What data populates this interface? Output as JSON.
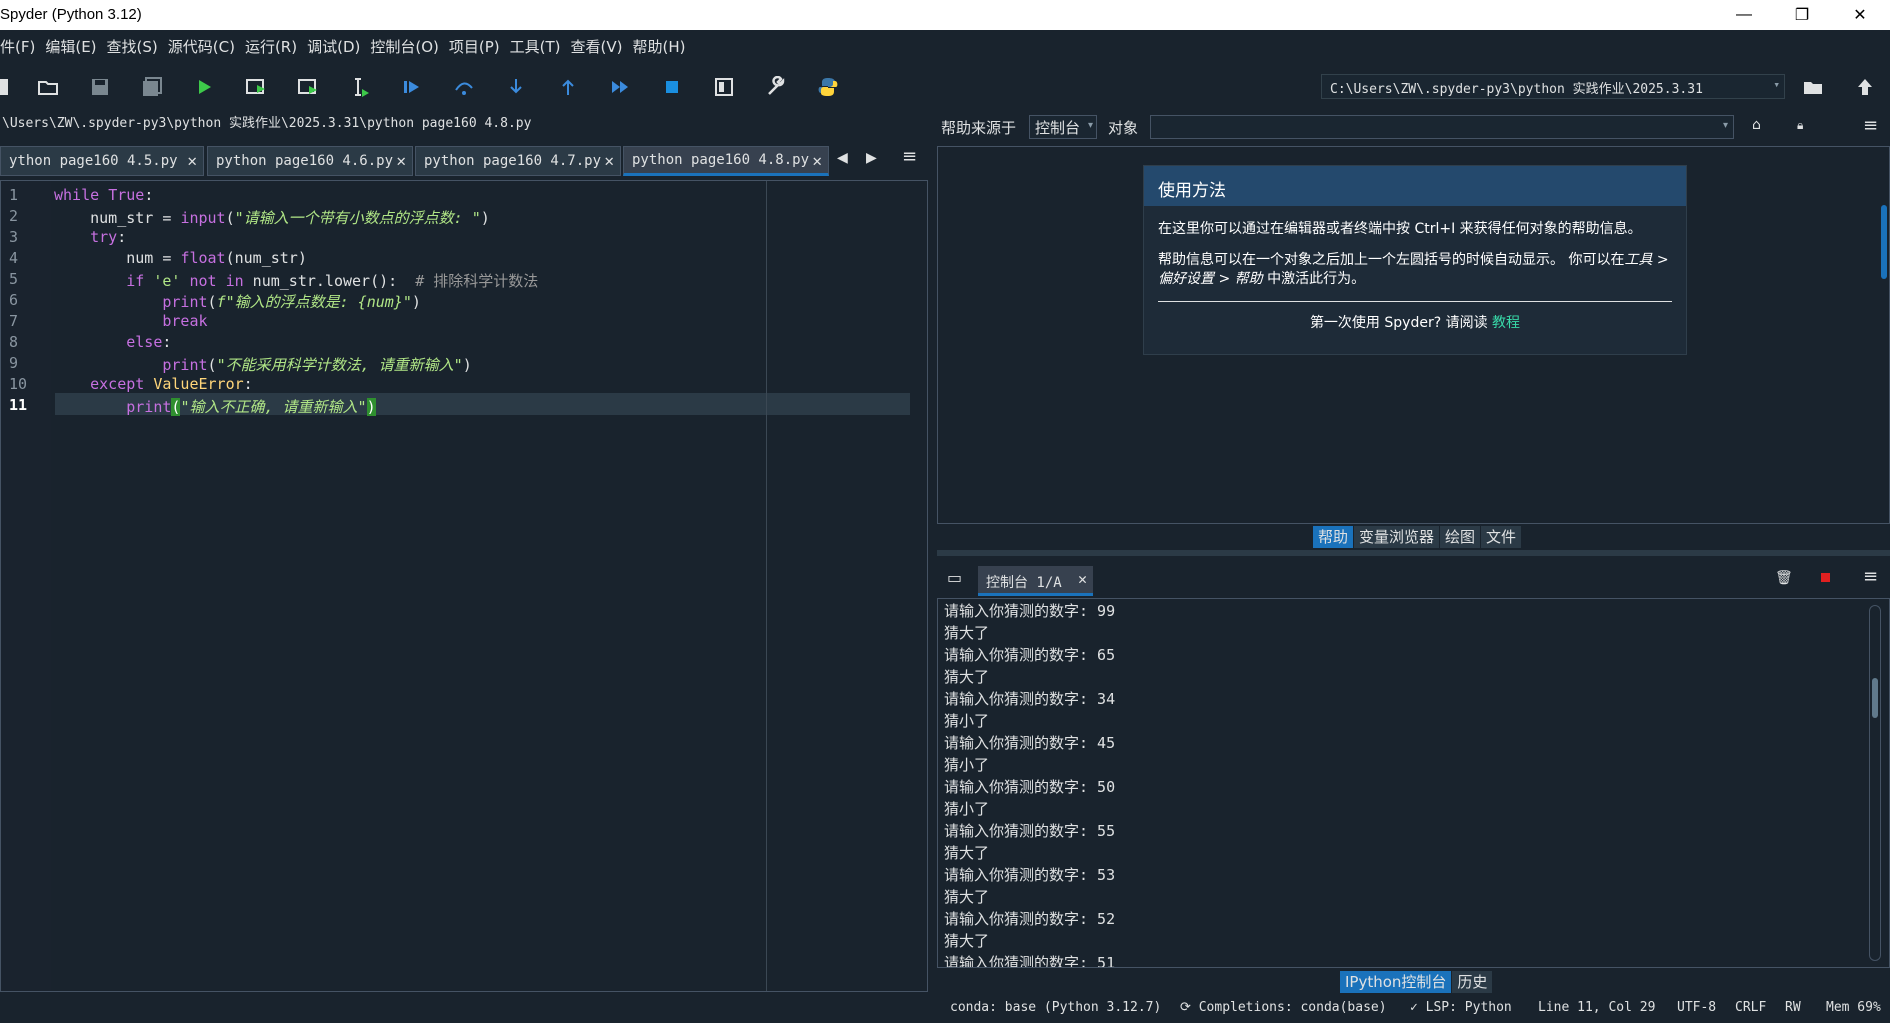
{
  "window": {
    "title": "Spyder (Python 3.12)",
    "minimize": "—",
    "restore": "❐",
    "close": "✕"
  },
  "menu": [
    "件(F)",
    "编辑(E)",
    "查找(S)",
    "源代码(C)",
    "运行(R)",
    "调试(D)",
    "控制台(O)",
    "项目(P)",
    "工具(T)",
    "查看(V)",
    "帮助(H)"
  ],
  "toolbar": {
    "path": "C:\\Users\\ZW\\.spyder-py3\\python 实践作业\\2025.3.31",
    "icons": [
      "new-file-icon",
      "open-folder-icon",
      "save-icon",
      "save-all-icon",
      "run-icon",
      "run-cell-icon",
      "run-cell-advance-icon",
      "run-selection-icon",
      "debug-icon",
      "step-over-icon",
      "step-into-icon",
      "step-return-icon",
      "continue-icon",
      "stop-icon",
      "maximize-pane-icon",
      "preferences-wrench-icon",
      "python-path-icon"
    ]
  },
  "editor": {
    "file_path": "\\Users\\ZW\\.spyder-py3\\python 实践作业\\2025.3.31\\python page160 4.8.py",
    "tabs": [
      "ython page160 4.5.py",
      "python page160 4.6.py",
      "python page160 4.7.py",
      "python page160 4.8.py"
    ],
    "active_tab": 3,
    "line_numbers": [
      "1",
      "2",
      "3",
      "4",
      "5",
      "6",
      "7",
      "8",
      "9",
      "10",
      "11"
    ],
    "current_line": 11
  },
  "help": {
    "source_label": "帮助来源于",
    "source_value": "控制台",
    "object_label": "对象",
    "object_value": "",
    "card_title": "使用方法",
    "para1": "在这里你可以通过在编辑器或者终端中按 Ctrl+I 来获得任何对象的帮助信息。",
    "para2a": "帮助信息可以在一个对象之后加上一个左圆括号的时候自动显示。 你可以在",
    "para2b": "工具 > 偏好设置 > 帮助",
    "para2c": " 中激活此行为。",
    "first_time": "第一次使用 Spyder? 请阅读 ",
    "tutorial_link": "教程",
    "pane_tabs": [
      "帮助",
      "变量浏览器",
      "绘图",
      "文件"
    ]
  },
  "console": {
    "tab_label": "控制台 1/A",
    "lines": [
      "请输入你猜测的数字: 99",
      "猜大了",
      "请输入你猜测的数字: 65",
      "猜大了",
      "请输入你猜测的数字: 34",
      "猜小了",
      "请输入你猜测的数字: 45",
      "猜小了",
      "请输入你猜测的数字: 50",
      "猜小了",
      "请输入你猜测的数字: 55",
      "猜大了",
      "请输入你猜测的数字: 53",
      "猜大了",
      "请输入你猜测的数字: 52",
      "猜大了",
      "请输入你猜测的数字: 51"
    ],
    "pane_tabs": [
      "IPython控制台",
      "历史"
    ]
  },
  "status": {
    "conda": "conda: base (Python 3.12.7)",
    "completions": "⟳ Completions: conda(base)",
    "lsp": "✓ LSP: Python",
    "position": "Line 11, Col 29",
    "encoding": "UTF-8",
    "eol": "CRLF",
    "mode": "RW",
    "mem": "Mem 69%"
  }
}
